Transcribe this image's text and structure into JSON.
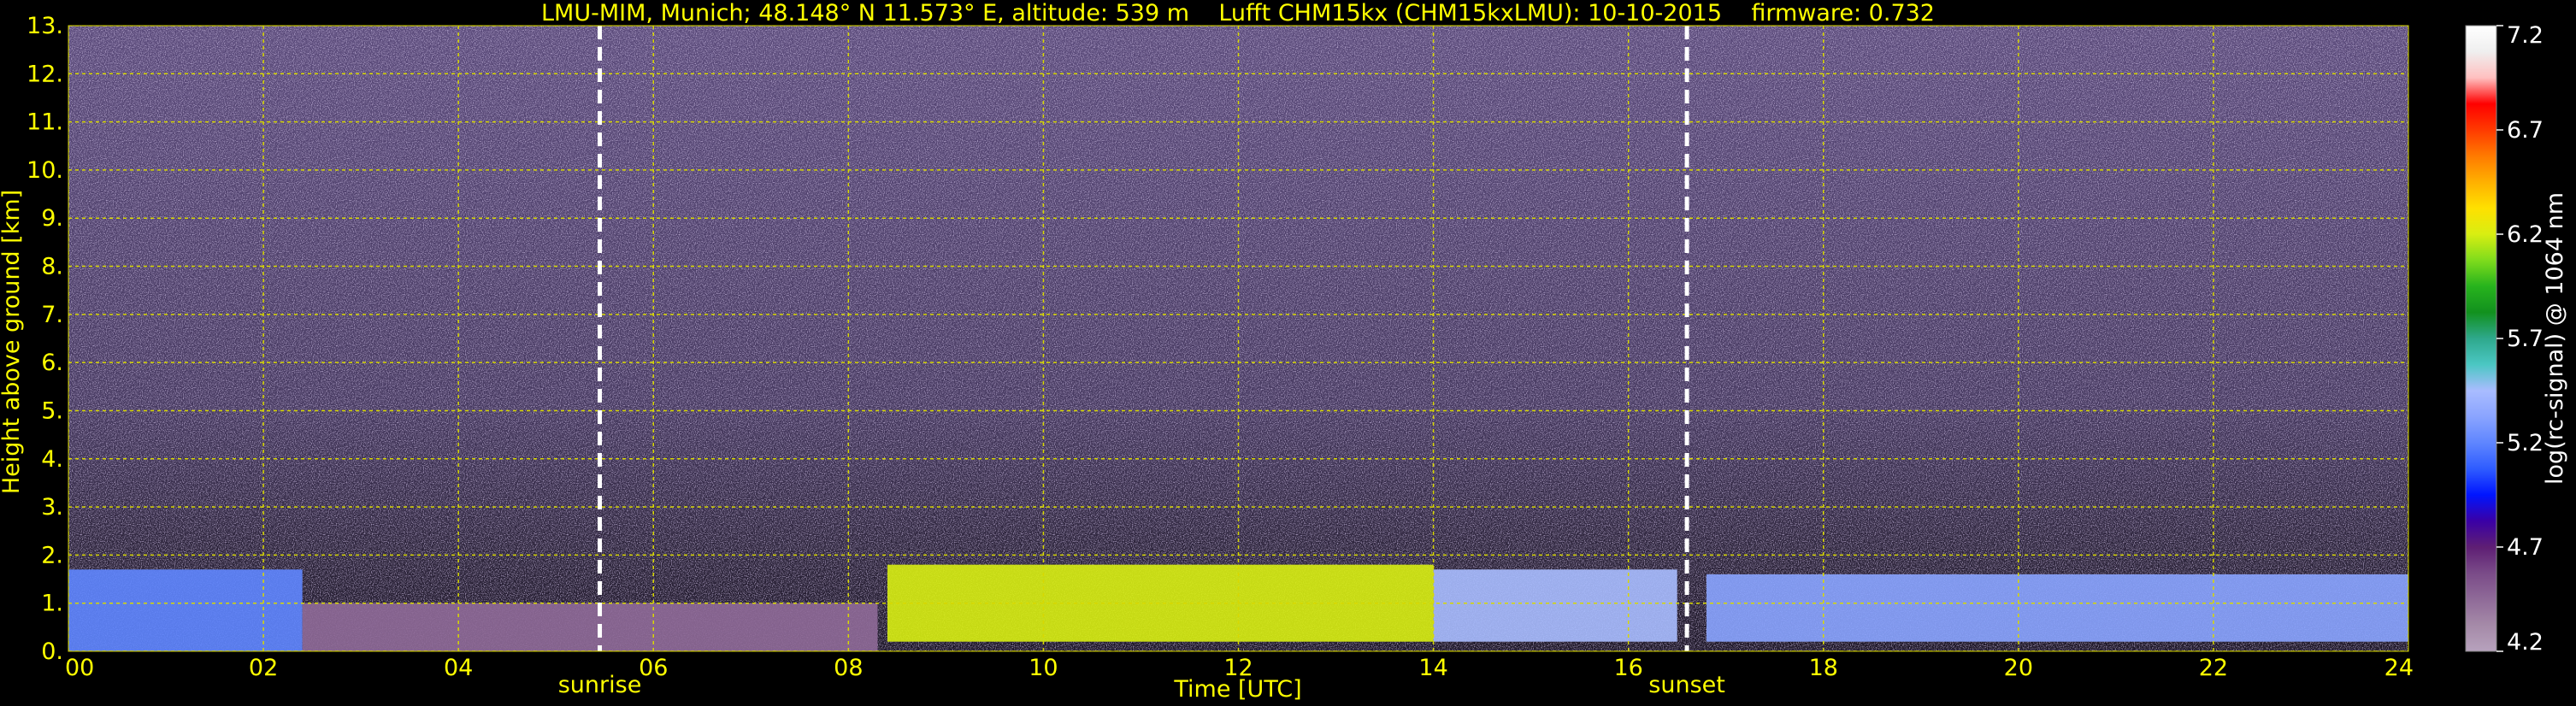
{
  "chart_data": {
    "type": "heatmap",
    "title": "LMU-MIM, Munich; 48.148° N 11.573° E, altitude: 539 m    Lufft CHM15kx (CHM15kxLMU): 10-10-2015    firmware: 0.732",
    "xlabel": "Time [UTC]",
    "ylabel": "Height above ground [km]",
    "xlim": [
      0,
      24
    ],
    "ylim": [
      0,
      13
    ],
    "x_ticks": [
      "00",
      "02",
      "04",
      "06",
      "08",
      "10",
      "12",
      "14",
      "16",
      "18",
      "20",
      "22",
      "24"
    ],
    "y_ticks": [
      "0.",
      "1.",
      "2.",
      "3.",
      "4.",
      "5.",
      "6.",
      "7.",
      "8.",
      "9.",
      "10.",
      "11.",
      "12.",
      "13."
    ],
    "grid": true,
    "markers": [
      {
        "label": "sunrise",
        "time": 5.45
      },
      {
        "label": "sunset",
        "time": 16.6
      }
    ],
    "colorbar": {
      "label": "log(rc-signal) @ 1064 nm",
      "ticks": [
        "4.2",
        "4.7",
        "5.2",
        "5.7",
        "6.2",
        "6.7",
        "7.2"
      ],
      "range": [
        4.2,
        7.2
      ],
      "colors": [
        "#b7a2bd",
        "#a58aa8",
        "#8f6a98",
        "#7a4b88",
        "#5e1e74",
        "#3a00a6",
        "#0015ff",
        "#2f5cff",
        "#5f86ff",
        "#8aa4ff",
        "#a9bcff",
        "#4bc7c3",
        "#2ea88c",
        "#12911e",
        "#27b31d",
        "#7fdc1c",
        "#d8ee12",
        "#ffe000",
        "#ffb000",
        "#ff7a00",
        "#ff3a00",
        "#ff0000",
        "#ffc0c0",
        "#efefef",
        "#ffffff"
      ]
    },
    "layers": [
      {
        "t0": 0.0,
        "t1": 2.4,
        "z0": 0.0,
        "z1": 1.7,
        "value": 5.2
      },
      {
        "t0": 2.4,
        "t1": 8.3,
        "z0": 0.0,
        "z1": 1.0,
        "value": 4.4
      },
      {
        "t0": 8.4,
        "t1": 14.0,
        "z0": 0.2,
        "z1": 1.8,
        "value": 6.2
      },
      {
        "t0": 14.0,
        "t1": 16.5,
        "z0": 0.2,
        "z1": 1.7,
        "value": 5.4
      },
      {
        "t0": 16.8,
        "t1": 24.0,
        "z0": 0.2,
        "z1": 1.6,
        "value": 5.3
      }
    ]
  }
}
